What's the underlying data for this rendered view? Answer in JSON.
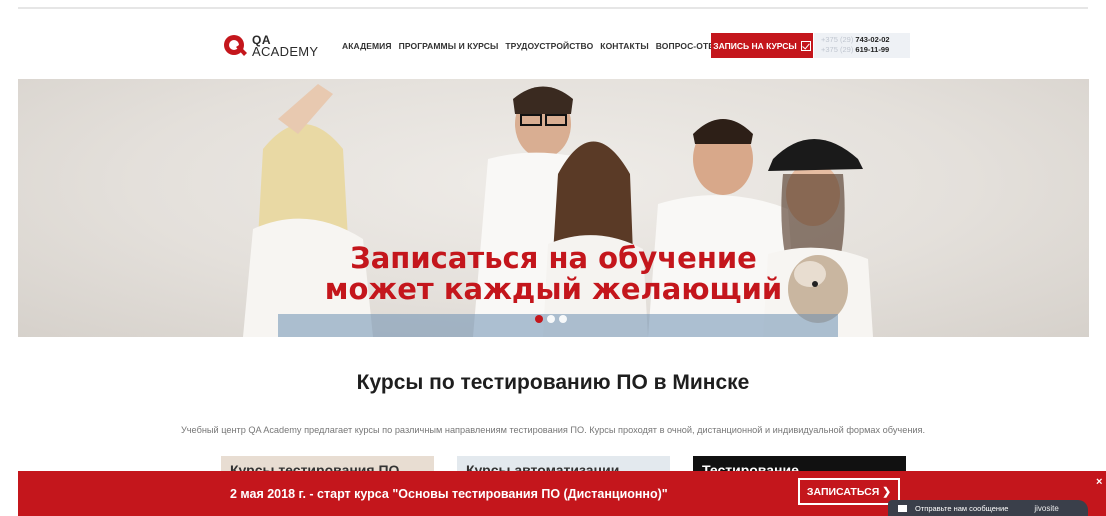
{
  "header": {
    "logo_line1": "QA",
    "logo_line2": "ACADEMY",
    "nav": [
      "АКАДЕМИЯ",
      "ПРОГРАММЫ И КУРСЫ",
      "ТРУДОУСТРОЙСТВО",
      "КОНТАКТЫ",
      "ВОПРОС-ОТВЕТ"
    ],
    "cta_label": "ЗАПИСЬ НА КУРСЫ",
    "cta_icon": "check-square-icon",
    "phones": [
      {
        "prefix": "+375 (29) ",
        "number": "743-02-02"
      },
      {
        "prefix": "+375 (29) ",
        "number": "619-11-99"
      }
    ],
    "brand_color": "#c4161c"
  },
  "hero": {
    "title_line1": "Записаться на обучение",
    "title_line2": "может каждый желающий",
    "slide_count": 3,
    "active_slide": 1
  },
  "main": {
    "title": "Курсы по тестированию ПО в Минске",
    "description": "Учебный центр QA Academy предлагает курсы по различным направлениям тестирования ПО. Курсы проходят в очной, дистанционной и индивидуальной формах обучения.",
    "cards": [
      "Курсы тестирования ПО",
      "Курсы автоматизации",
      "Тестирование"
    ]
  },
  "promo": {
    "text": "2 мая 2018 г. - старт курса \"Основы тестирования ПО (Дистанционно)\"",
    "button_label": "ЗАПИСАТЬСЯ",
    "button_icon": "chevron-right-icon",
    "close_icon": "close-icon"
  },
  "chat": {
    "label": "Отправьте нам сообщение",
    "brand": "jivosite",
    "icon": "mail-icon"
  }
}
